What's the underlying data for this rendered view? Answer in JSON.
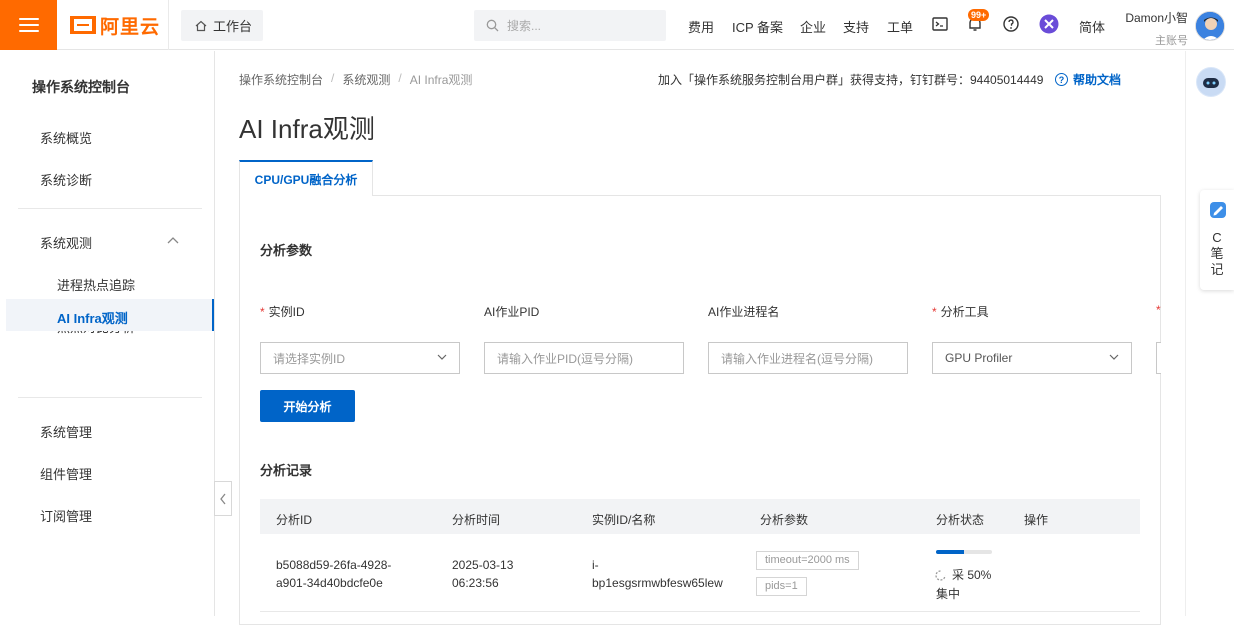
{
  "topbar": {
    "logo_text": "阿里云",
    "workbench_label": "工作台",
    "search_placeholder": "搜索...",
    "nav": [
      "费用",
      "ICP 备案",
      "企业",
      "支持",
      "工单"
    ],
    "notification_badge": "99+",
    "language": "简体",
    "user_name": "Damon小智",
    "user_role": "主账号"
  },
  "sidebar": {
    "title": "操作系统控制台",
    "items": {
      "overview": "系统概览",
      "diagnosis": "系统诊断",
      "observe": "系统观测",
      "hotspot_trace": "进程热点追踪",
      "hotspot_compare": "热点对比分析",
      "ai_infra": "AI Infra观测",
      "manage": "系统管理",
      "component": "组件管理",
      "subscribe": "订阅管理"
    }
  },
  "breadcrumb": [
    "操作系统控制台",
    "系统观测",
    "AI Infra观测"
  ],
  "help": {
    "join_text": "加入「操作系统服务控制台用户群」获得支持，钉钉群号：94405014449",
    "doc_link": "帮助文档"
  },
  "page_title": "AI Infra观测",
  "tab_label": "CPU/GPU融合分析",
  "params": {
    "section_title": "分析参数",
    "instance_label": "实例ID",
    "instance_placeholder": "请选择实例ID",
    "pid_label": "AI作业PID",
    "pid_placeholder": "请输入作业PID(逗号分隔)",
    "proc_label": "AI作业进程名",
    "proc_placeholder": "请输入作业进程名(逗号分隔)",
    "tool_label": "分析工具",
    "tool_value": "GPU Profiler",
    "start_button": "开始分析"
  },
  "records": {
    "section_title": "分析记录",
    "columns": [
      "分析ID",
      "分析时间",
      "实例ID/名称",
      "分析参数",
      "分析状态",
      "操作"
    ],
    "rows": [
      {
        "id_line1": "b5088d59-26fa-4928-",
        "id_line2": "a901-34d40bdcfe0e",
        "time_line1": "2025-03-13",
        "time_line2": "06:23:56",
        "instance_line1": "i-",
        "instance_line2": "bp1esgsrmwbfesw65lew",
        "param_tag1": "timeout=2000 ms",
        "param_tag2": "pids=1",
        "status_text": "采 50%",
        "status_text2": "集中",
        "progress_fraction": 0.5
      }
    ]
  },
  "right_rail": {
    "note_text": "C笔记"
  },
  "colors": {
    "brand_orange": "#ff6a00",
    "primary_blue": "#0064c8"
  }
}
